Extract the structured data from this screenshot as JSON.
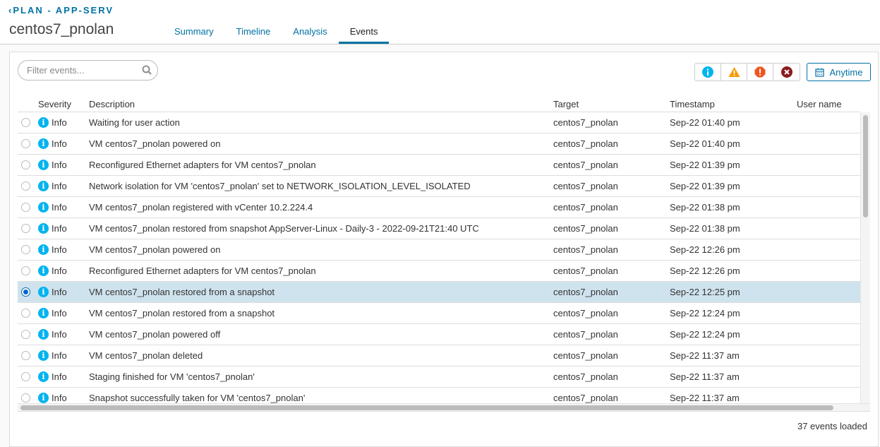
{
  "header": {
    "back_label": "PLAN - APP-SERV",
    "title": "centos7_pnolan",
    "tabs": [
      {
        "label": "Summary"
      },
      {
        "label": "Timeline"
      },
      {
        "label": "Analysis"
      },
      {
        "label": "Events",
        "active": true
      }
    ]
  },
  "toolbar": {
    "filter_placeholder": "Filter events...",
    "severity_filters": [
      "info-icon",
      "warning-icon",
      "error-icon",
      "critical-icon"
    ],
    "time_button": "Anytime"
  },
  "table": {
    "columns": [
      "Severity",
      "Description",
      "Target",
      "Timestamp",
      "User name"
    ],
    "rows": [
      {
        "severity": "Info",
        "description": "Waiting for user action",
        "target": "centos7_pnolan",
        "timestamp": "Sep-22 01:40 pm",
        "user": ""
      },
      {
        "severity": "Info",
        "description": "VM centos7_pnolan powered on",
        "target": "centos7_pnolan",
        "timestamp": "Sep-22 01:40 pm",
        "user": ""
      },
      {
        "severity": "Info",
        "description": "Reconfigured Ethernet adapters for VM centos7_pnolan",
        "target": "centos7_pnolan",
        "timestamp": "Sep-22 01:39 pm",
        "user": ""
      },
      {
        "severity": "Info",
        "description": "Network isolation for VM 'centos7_pnolan' set to NETWORK_ISOLATION_LEVEL_ISOLATED",
        "target": "centos7_pnolan",
        "timestamp": "Sep-22 01:39 pm",
        "user": ""
      },
      {
        "severity": "Info",
        "description": "VM centos7_pnolan registered with vCenter 10.2.224.4",
        "target": "centos7_pnolan",
        "timestamp": "Sep-22 01:38 pm",
        "user": ""
      },
      {
        "severity": "Info",
        "description": "VM centos7_pnolan restored from snapshot AppServer-Linux - Daily-3 - 2022-09-21T21:40 UTC",
        "target": "centos7_pnolan",
        "timestamp": "Sep-22 01:38 pm",
        "user": ""
      },
      {
        "severity": "Info",
        "description": "VM centos7_pnolan powered on",
        "target": "centos7_pnolan",
        "timestamp": "Sep-22 12:26 pm",
        "user": ""
      },
      {
        "severity": "Info",
        "description": "Reconfigured Ethernet adapters for VM centos7_pnolan",
        "target": "centos7_pnolan",
        "timestamp": "Sep-22 12:26 pm",
        "user": ""
      },
      {
        "severity": "Info",
        "description": "VM centos7_pnolan restored from a snapshot",
        "target": "centos7_pnolan",
        "timestamp": "Sep-22 12:25 pm",
        "user": "",
        "selected": true
      },
      {
        "severity": "Info",
        "description": "VM centos7_pnolan restored from a snapshot",
        "target": "centos7_pnolan",
        "timestamp": "Sep-22 12:24 pm",
        "user": ""
      },
      {
        "severity": "Info",
        "description": "VM centos7_pnolan powered off",
        "target": "centos7_pnolan",
        "timestamp": "Sep-22 12:24 pm",
        "user": ""
      },
      {
        "severity": "Info",
        "description": "VM centos7_pnolan deleted",
        "target": "centos7_pnolan",
        "timestamp": "Sep-22 11:37 am",
        "user": ""
      },
      {
        "severity": "Info",
        "description": "Staging finished for VM 'centos7_pnolan'",
        "target": "centos7_pnolan",
        "timestamp": "Sep-22 11:37 am",
        "user": ""
      },
      {
        "severity": "Info",
        "description": "Snapshot successfully taken for VM 'centos7_pnolan'",
        "target": "centos7_pnolan",
        "timestamp": "Sep-22 11:37 am",
        "user": ""
      }
    ]
  },
  "footer": {
    "status": "37 events loaded"
  },
  "colors": {
    "accent": "#0072a3",
    "info": "#00b4f0",
    "warning": "#f89a00",
    "error": "#f0541e",
    "critical": "#8b1b1b",
    "selected_row": "#cfe3ee"
  }
}
